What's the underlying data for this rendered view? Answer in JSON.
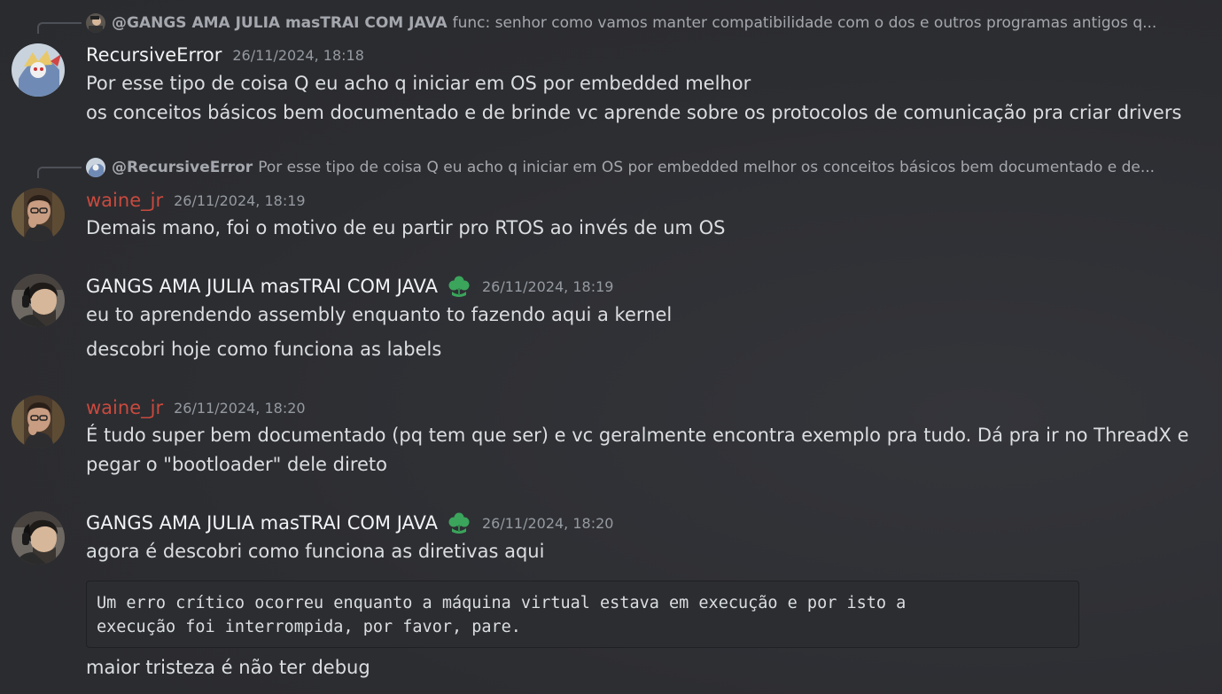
{
  "messages": [
    {
      "reply": {
        "author": "@GANGS AMA JULIA masTRAI COM JAVA",
        "text": "func: senhor como vamos manter compatibilidade com o dos e outros programas antigos q..."
      },
      "author": "RecursiveError",
      "timestamp": "26/11/2024, 18:18",
      "lines": [
        "Por esse tipo de coisa Q eu acho q iniciar em OS por embedded melhor",
        " os conceitos básicos bem documentado e de brinde vc aprende sobre os protocolos de comunicação pra criar drivers"
      ]
    },
    {
      "reply": {
        "author": "@RecursiveError",
        "text": "Por esse tipo de coisa Q eu acho q iniciar em OS por embedded melhor  os conceitos básicos bem documentado e de..."
      },
      "author": "waine_jr",
      "timestamp": "26/11/2024, 18:19",
      "lines": [
        "Demais mano, foi o motivo de eu partir pro RTOS ao invés de um OS"
      ]
    },
    {
      "author": "GANGS AMA JULIA masTRAI COM JAVA",
      "timestamp": "26/11/2024, 18:19",
      "lines": [
        "eu to aprendendo assembly enquanto to fazendo aqui a kernel",
        "descobri hoje como funciona as labels"
      ]
    },
    {
      "author": "waine_jr",
      "timestamp": "26/11/2024, 18:20",
      "lines": [
        "É tudo super bem documentado (pq tem que ser) e vc geralmente encontra exemplo pra tudo. Dá pra ir no ThreadX e",
        "pegar o \"bootloader\" dele direto"
      ]
    },
    {
      "author": "GANGS AMA JULIA masTRAI COM JAVA",
      "timestamp": "26/11/2024, 18:20",
      "lines": [
        "agora é descobri como funciona as diretivas aqui"
      ],
      "code": "Um erro crítico ocorreu enquanto a máquina virtual estava em execução e por isto a\nexecução foi interrompida, por favor, pare.",
      "after_code": "maior tristeza é não ter debug"
    }
  ],
  "colors": {
    "background": "#2e2f33",
    "username_default": "#f2f3f5",
    "username_red": "#c84a3e",
    "timestamp": "#959aa1",
    "text": "#dbdee1",
    "badge": "#3ba55c"
  },
  "icons": {
    "badge": "green-flower-badge-icon"
  }
}
